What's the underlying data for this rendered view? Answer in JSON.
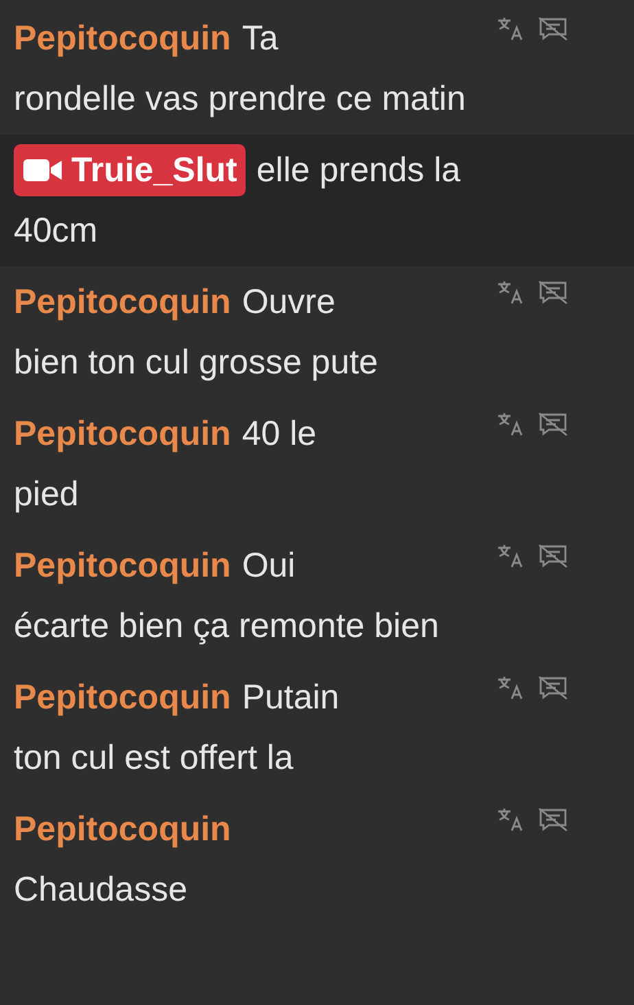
{
  "messages": [
    {
      "kind": "user",
      "username": "Pepitocoquin",
      "text_start": "Ta",
      "text_rest": "rondelle vas prendre ce matin"
    },
    {
      "kind": "highlight",
      "username": "Truie_Slut",
      "text_start": "elle prends la",
      "text_rest": "40cm"
    },
    {
      "kind": "user",
      "username": "Pepitocoquin",
      "text_start": "Ouvre",
      "text_rest": "bien ton cul grosse pute"
    },
    {
      "kind": "user",
      "username": "Pepitocoquin",
      "text_start": "40 le",
      "text_rest": "pied"
    },
    {
      "kind": "user",
      "username": "Pepitocoquin",
      "text_start": "Oui",
      "text_rest": "écarte bien ça remonte bien"
    },
    {
      "kind": "user",
      "username": "Pepitocoquin",
      "text_start": "Putain",
      "text_rest": "ton cul est offert la"
    },
    {
      "kind": "user",
      "username": "Pepitocoquin",
      "text_rest": "Chaudasse"
    }
  ]
}
